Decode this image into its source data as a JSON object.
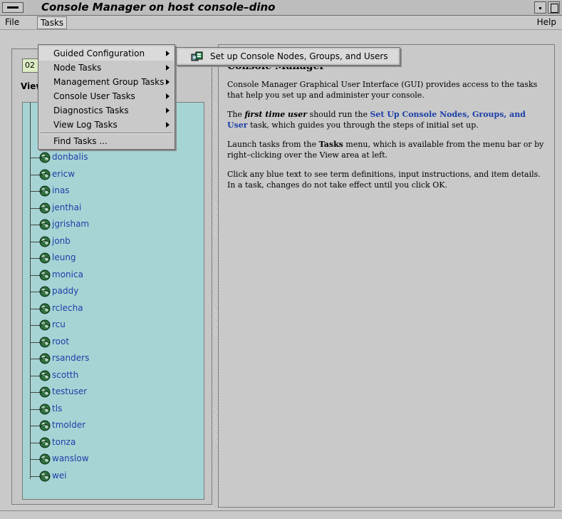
{
  "window": {
    "title": "Console Manager on host console–dino"
  },
  "menubar": {
    "file": "File",
    "tasks": "Tasks",
    "help": "Help"
  },
  "tasks_menu": {
    "items": [
      {
        "label": "Guided Configuration",
        "submenu": true
      },
      {
        "label": "Node Tasks",
        "submenu": true
      },
      {
        "label": "Management Group Tasks",
        "submenu": true
      },
      {
        "label": "Console User Tasks",
        "submenu": true
      },
      {
        "label": "Diagnostics Tasks",
        "submenu": true
      },
      {
        "label": "View Log Tasks",
        "submenu": true
      }
    ],
    "find_tasks": "Find Tasks ..."
  },
  "guided_submenu": {
    "item": "Set up Console Nodes, Groups, and Users",
    "icon": "task-wizard-icon"
  },
  "left": {
    "combo_value": "02",
    "view_label": "View",
    "users": [
      "donbalis",
      "ericw",
      "inas",
      "jenthai",
      "jgrisham",
      "jonb",
      "leung",
      "monica",
      "paddy",
      "rclecha",
      "rcu",
      "root",
      "rsanders",
      "scotth",
      "testuser",
      "tls",
      "tmolder",
      "tonza",
      "wanslow",
      "wei"
    ],
    "user_icon": "user-globe-icon"
  },
  "right": {
    "heading": "Console Manager",
    "p1": "Console Manager Graphical User Interface (GUI) provides access to the tasks that help you set up and administer your console.",
    "p2_a": "The ",
    "p2_em": "first time user",
    "p2_b": " should run the ",
    "p2_link": "Set Up Console Nodes, Groups, and User",
    "p2_c": " task, which guides you through the steps of initial set up.",
    "p3_a": "Launch tasks from the ",
    "p3_bold": "Tasks",
    "p3_b": " menu, which is available from the menu bar or by right–clicking over the View area at left.",
    "p4": "Click any blue text to see term definitions, input instructions, and item details. In a task, changes do not take effect until you click OK."
  },
  "colors": {
    "tree_bg": "#a6d4d4",
    "link": "#1c3fa8",
    "window_bg": "#c9c9c9"
  }
}
